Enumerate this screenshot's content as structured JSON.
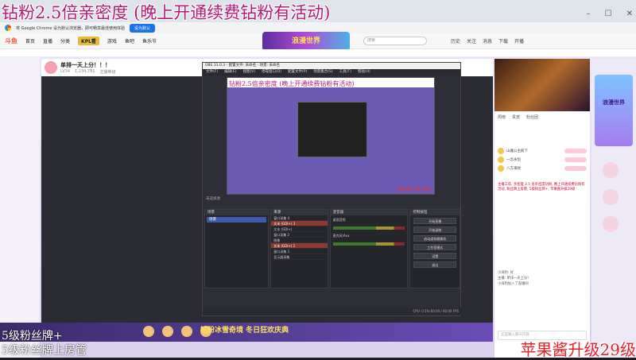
{
  "overlay": {
    "top_text": "钻粉2.5倍亲密度 (晚上开通续费钻粉有活动)",
    "bottom_left_1": "5级粉丝牌+",
    "bottom_left_2": "5级粉丝牌上房管",
    "bottom_right": "苹果酱升级29级"
  },
  "chrome": {
    "info_text": "将 Google Chrome 设为默认浏览器，即可畅享最佳使用体验",
    "set_default": "设为默认"
  },
  "site_nav": {
    "logo": "斗鱼",
    "items": [
      "首页",
      "直播",
      "分类",
      "KPL看",
      "游戏",
      "鱼吧",
      "鱼乐节"
    ],
    "search_placeholder": "搜索",
    "right_items": [
      "历史",
      "关注",
      "消息",
      "下载",
      "开播"
    ]
  },
  "banner_text": "浪漫世界",
  "streamer": {
    "title": "单排一天上分！！！",
    "meta": [
      "LV34",
      "1,234,781",
      "主播等级"
    ]
  },
  "obs": {
    "title": "OBS 31.0.3 - 配置文件: 未命名 - 场景: 未命名",
    "menu": [
      "文件(F)",
      "编辑(E)",
      "视图(V)",
      "停靠窗口(D)",
      "配置文件(P)",
      "场景集合(S)",
      "工具(T)",
      "帮助(H)"
    ],
    "preview_title": "钻粉2.5倍亲密度 (晚上开通续费钻粉有活动)",
    "preview_red": "苹果酱升级29级",
    "label": "未选择源",
    "docks": {
      "scenes": "场景",
      "sources": "来源",
      "mixer": "混音器",
      "controls": "控制按钮"
    },
    "scene_item": "场景",
    "sources": [
      {
        "name": "窗口采集 4",
        "red": false
      },
      {
        "name": "文本 (GDI+) 3",
        "red": true
      },
      {
        "name": "文本 (GDI+)",
        "red": false
      },
      {
        "name": "窗口采集 2",
        "red": false
      },
      {
        "name": "图像",
        "red": false
      },
      {
        "name": "文本 (GDI+) 2",
        "red": true
      },
      {
        "name": "窗口采集 3",
        "red": false
      },
      {
        "name": "显示器采集",
        "red": false
      }
    ],
    "mixer_tracks": [
      "桌面音频",
      "麦克风/Aux"
    ],
    "controls": [
      "开始直播",
      "开始录制",
      "启动虚拟摄像机",
      "工作室模式",
      "设置",
      "退出"
    ],
    "status": "CPU: 0.5%  60.00 / 60.00 FPS"
  },
  "right_panel": {
    "tabs": [
      "周榜",
      "贵宾",
      "粉丝团"
    ],
    "ranks": [
      "山雅公主殿下",
      "一念永恒",
      "八方来财"
    ],
    "chat_notice": "主播三年, 亲密度 2.5 倍亲密度钻粉, 晚上开通续费钻粉有活动, 粉丝牌上房管, 5级粉丝牌+, 苹果酱升级29级",
    "chat_msgs": [
      "小海豹: 好",
      "主播: 单排一天上分!",
      "小海豹加入了直播间"
    ],
    "input_placeholder": "这里输入聊天内容"
  },
  "far_right": {
    "ad_text": "浪漫世界"
  },
  "gift_banner": "钻粉冰雪奇境 冬日狂欢庆典"
}
